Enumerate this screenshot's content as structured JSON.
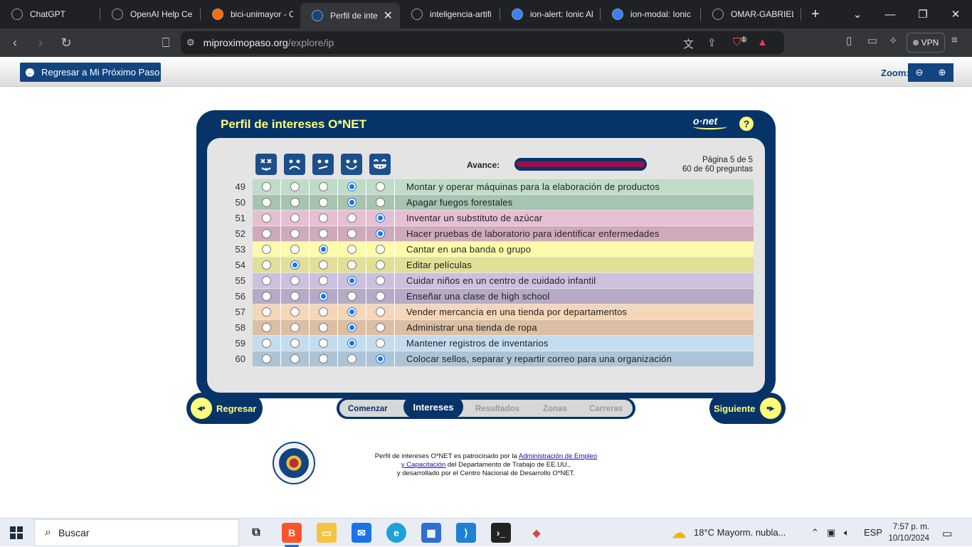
{
  "browser": {
    "tabs": [
      {
        "title": "ChatGPT",
        "icon": "chatgpt-icon",
        "color": "#202124"
      },
      {
        "title": "OpenAI Help Cen",
        "icon": "openai-icon",
        "color": "#202124"
      },
      {
        "title": "bici-unimayor - C",
        "icon": "firebase-icon",
        "color": "#ff6d00"
      },
      {
        "title": "Perfil de inte",
        "icon": "onet-icon",
        "color": "#12457f",
        "active": true
      },
      {
        "title": "inteligencia-artifi",
        "icon": "github-icon",
        "color": "#202124"
      },
      {
        "title": "ion-alert: Ionic Al",
        "icon": "ionic-icon",
        "color": "#3880ff"
      },
      {
        "title": "ion-modal: Ionic",
        "icon": "ionic-icon",
        "color": "#3880ff"
      },
      {
        "title": "OMAR-GABRIEL/",
        "icon": "github-icon",
        "color": "#202124"
      }
    ],
    "url_host": "miproximopaso.org",
    "url_path": "/explore/ip",
    "vpn_label": "VPN",
    "brave_badge": "1"
  },
  "page": {
    "back_button": "Regresar a Mi Próximo Paso",
    "zoom_label": "Zoom:"
  },
  "panel": {
    "title": "Perfil de intereses O*NET",
    "logo_text": "o·net",
    "help": "?",
    "progress_label": "Avance:",
    "progress_fraction": 1.0,
    "page_line1": "Página 5 de 5",
    "page_line2": "60 de 60 preguntas",
    "faces": [
      "strongly-dislike-face-icon",
      "dislike-face-icon",
      "unsure-face-icon",
      "like-face-icon",
      "strongly-like-face-icon"
    ]
  },
  "questions": [
    {
      "num": "49",
      "text": "Montar y operar máquinas para la elaboración de productos",
      "selected": 3,
      "bg": "#bedcc8"
    },
    {
      "num": "50",
      "text": "Apagar fuegos forestales",
      "selected": 3,
      "bg": "#a7c4b0"
    },
    {
      "num": "51",
      "text": "Inventar un substituto de azúcar",
      "selected": 4,
      "bg": "#e6bfd3"
    },
    {
      "num": "52",
      "text": "Hacer pruebas de laboratorio para identificar enfermedades",
      "selected": 4,
      "bg": "#ceaabc"
    },
    {
      "num": "53",
      "text": "Cantar en una banda o grupo",
      "selected": 2,
      "bg": "#fdfbab"
    },
    {
      "num": "54",
      "text": "Editar películas",
      "selected": 1,
      "bg": "#e2df98"
    },
    {
      "num": "55",
      "text": "Cuidar niños en un centro de cuidado infantil",
      "selected": 3,
      "bg": "#cdc0de"
    },
    {
      "num": "56",
      "text": "Enseñar una clase de high school",
      "selected": 2,
      "bg": "#b6aac6"
    },
    {
      "num": "57",
      "text": "Vender mercancía en una tienda por departamentos",
      "selected": 3,
      "bg": "#f4d6b8"
    },
    {
      "num": "58",
      "text": "Administrar una tienda de ropa",
      "selected": 3,
      "bg": "#dcbfa3"
    },
    {
      "num": "59",
      "text": "Mantener registros de inventarios",
      "selected": 3,
      "bg": "#c4dcef"
    },
    {
      "num": "60",
      "text": "Colocar sellos, separar y repartir correo para una organización",
      "selected": 4,
      "bg": "#acc4d6"
    }
  ],
  "nav": {
    "back": "Regresar",
    "next": "Siguiente",
    "steps": {
      "start": "Comenzar",
      "interests": "Intereses",
      "results": "Resultados",
      "zones": "Zonas",
      "careers": "Carreras"
    }
  },
  "footer": {
    "line1_pre": "Perfil de intereses O*NET es patrocinado por la ",
    "link1": "Administración de Empleo",
    "link2": "y Capacitación",
    "line2_post": " del Departamento de Trabajo de EE.UU.,",
    "line3": "y desarrollado por el Centro Nacional de Desarrollo O*NET."
  },
  "taskbar": {
    "search_placeholder": "Buscar",
    "weather": "18°C  Mayorm. nubla...",
    "language": "ESP",
    "time": "7:57 p. m.",
    "date": "10/10/2024"
  }
}
